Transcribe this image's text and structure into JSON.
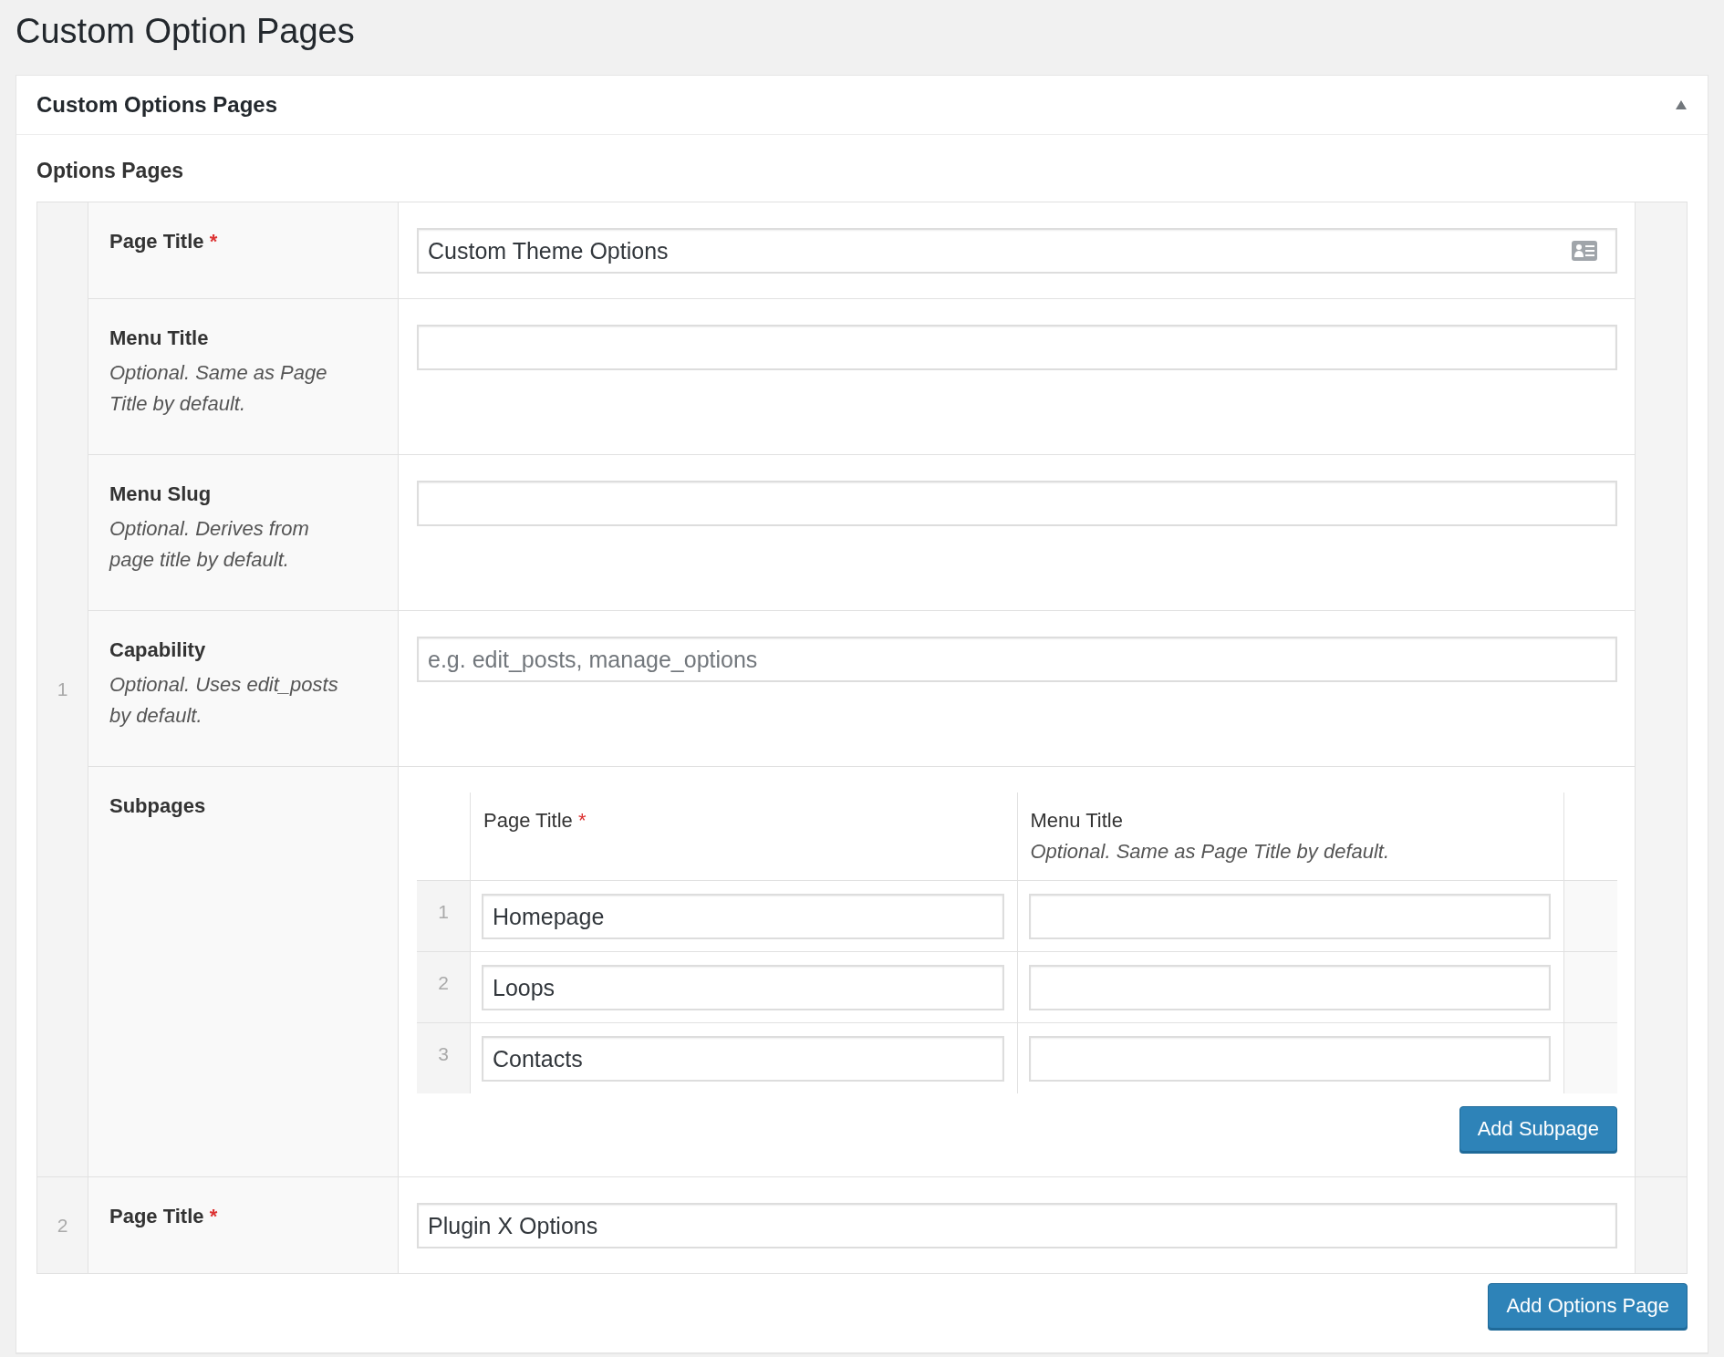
{
  "page": {
    "title": "Custom Option Pages"
  },
  "postbox": {
    "title": "Custom Options Pages",
    "expanded": true
  },
  "field": {
    "label": "Options Pages"
  },
  "rows": [
    {
      "index": "1",
      "fields": [
        {
          "kind": "text",
          "label": "Page Title",
          "required_mark": "*",
          "value": "Custom Theme Options",
          "autofill_icon": true
        },
        {
          "kind": "text",
          "label": "Menu Title",
          "description": "Optional. Same as Page Title by default."
        },
        {
          "kind": "text",
          "label": "Menu Slug",
          "description": "Optional. Derives from page title by default."
        },
        {
          "kind": "text",
          "label": "Capability",
          "description": "Optional. Uses edit_posts by default.",
          "placeholder": "e.g. edit_posts, manage_options"
        },
        {
          "kind": "subpages",
          "label": "Subpages",
          "columns": [
            {
              "label": "Page Title",
              "required_mark": "*"
            },
            {
              "label": "Menu Title",
              "description": "Optional. Same as Page Title by default."
            }
          ],
          "rows": [
            {
              "index": "1",
              "page_title": "Homepage"
            },
            {
              "index": "2",
              "page_title": "Loops"
            },
            {
              "index": "3",
              "page_title": "Contacts"
            }
          ],
          "button": "Add Subpage"
        }
      ]
    },
    {
      "index": "2",
      "fields": [
        {
          "kind": "text",
          "label": "Page Title",
          "required_mark": "*",
          "value": "Plugin X Options"
        }
      ]
    }
  ],
  "add_button": "Add Options Page"
}
